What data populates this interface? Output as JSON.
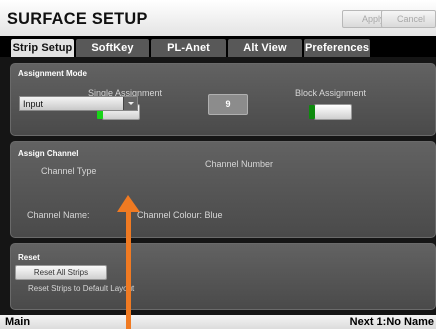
{
  "header": {
    "title": "SURFACE SETUP",
    "apply_label": "Apply",
    "cancel_label": "Cancel"
  },
  "tabs": [
    {
      "label": "Strip Setup",
      "active": true
    },
    {
      "label": "SoftKey Setup",
      "active": false
    },
    {
      "label": "PL-Anet Setup",
      "active": false
    },
    {
      "label": "Alt View Setup",
      "active": false
    },
    {
      "label": "Preferences",
      "active": false
    }
  ],
  "assignment_mode": {
    "title": "Assignment Mode",
    "single_label": "Single Assignment",
    "single_on": true,
    "block_label": "Block Assignment",
    "block_on": false
  },
  "assign_channel": {
    "title": "Assign Channel",
    "channel_type_label": "Channel Type",
    "channel_type_value": "Input",
    "channel_number_label": "Channel Number",
    "channel_number_value": "9",
    "channel_name_label": "Channel Name:",
    "channel_colour_label": "Channel Colour: Blue"
  },
  "reset": {
    "title": "Reset",
    "button_label": "Reset All Strips",
    "description": "Reset Strips to Default Layout"
  },
  "status_bar": {
    "left": "Main",
    "right": "Next 1:No Name"
  },
  "colors": {
    "accent_arrow": "#f07a22",
    "led_on": "#18d418",
    "led_off": "#0c8a0c"
  }
}
